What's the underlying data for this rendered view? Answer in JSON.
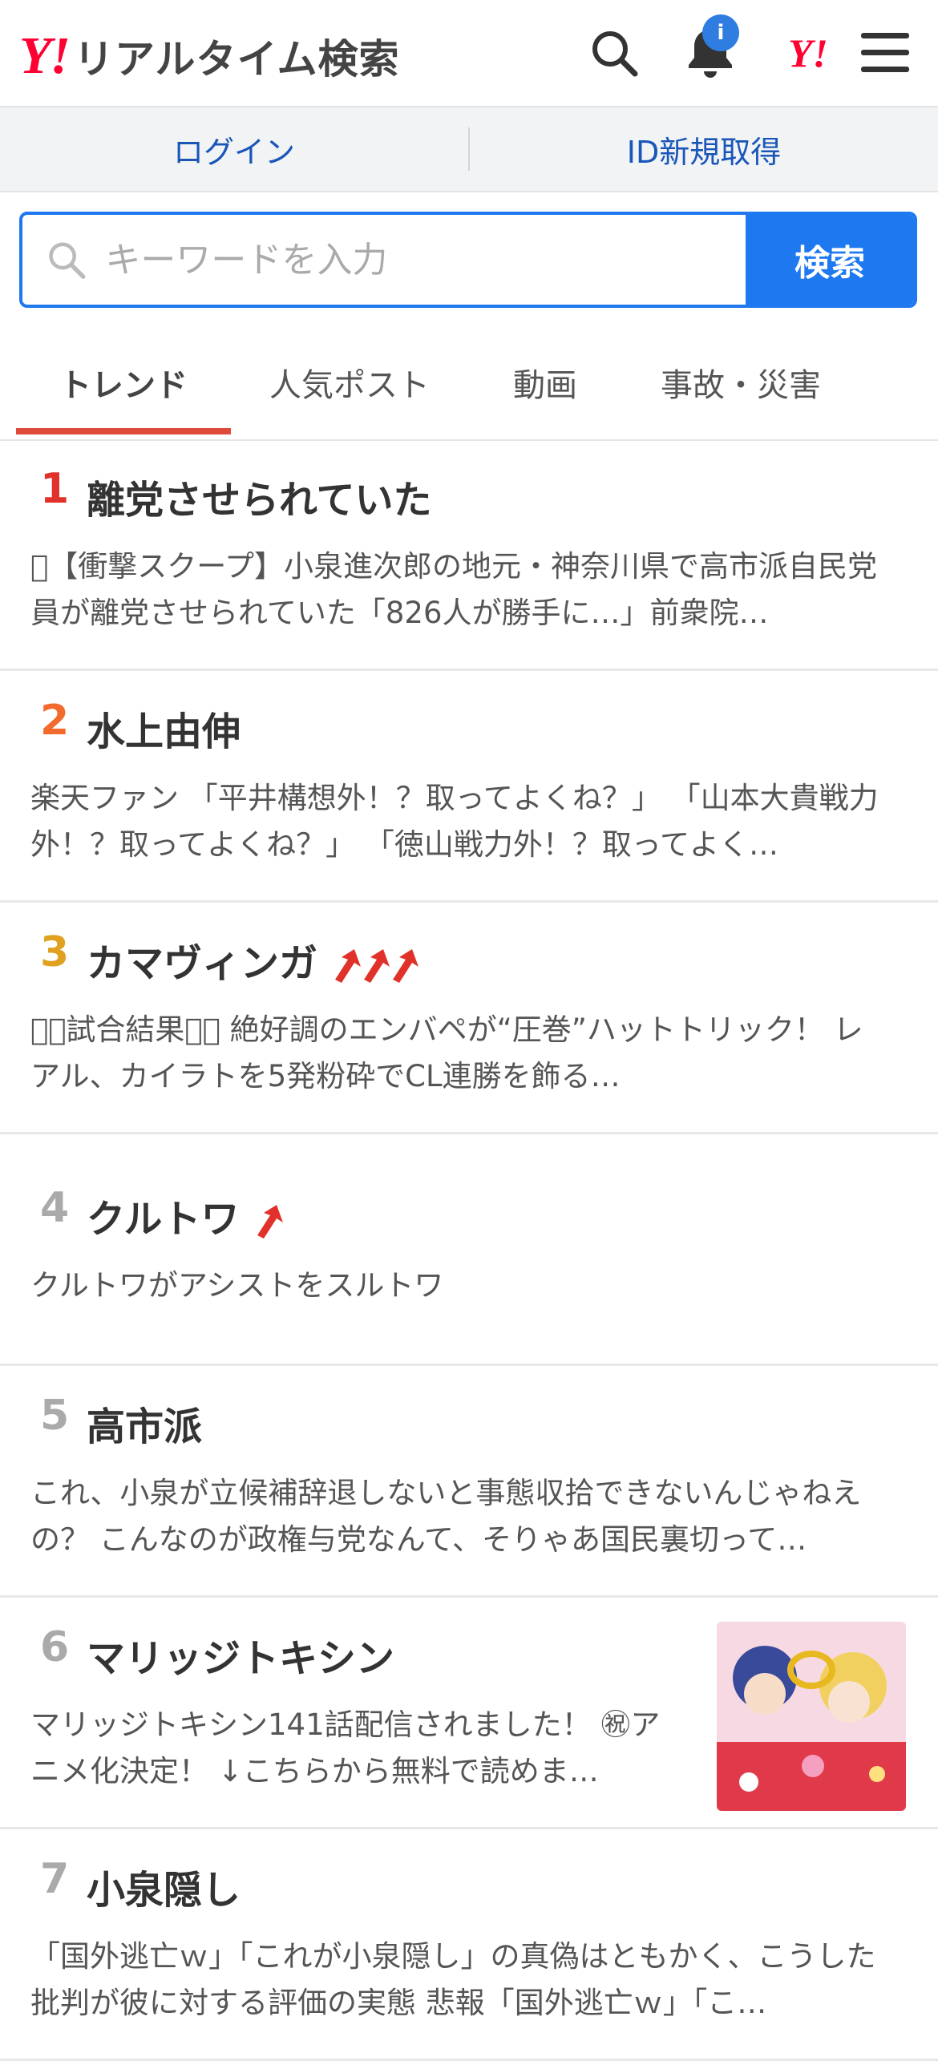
{
  "header": {
    "logo_mark": "Y!",
    "logo_text": "リアルタイム検索",
    "notification_badge": "i",
    "yahoo_mark": "Y!"
  },
  "login": {
    "login_label": "ログイン",
    "signup_label": "ID新規取得"
  },
  "search": {
    "placeholder": "キーワードを入力",
    "button_label": "検索"
  },
  "tabs": [
    {
      "label": "トレンド",
      "active": true
    },
    {
      "label": "人気ポスト"
    },
    {
      "label": "動画"
    },
    {
      "label": "事故・災害"
    }
  ],
  "colors": {
    "accent": "#1e78f0",
    "tab_underline": "#e04a3c",
    "rank1": "#e0322a",
    "rank2": "#f26a2c",
    "rank3": "#e0a020",
    "rank_other": "#aaaaaa",
    "trend_arrow": "#e0322a"
  },
  "trends": [
    {
      "rank": "1",
      "title": "離党させられていた",
      "arrows": 0,
      "desc": "􀀀【衝撃スクープ】小泉進次郎の地元・神奈川県で高市派自民党員が離党させられていた「826人が勝手に…」前衆院…"
    },
    {
      "rank": "2",
      "title": "水上由伸",
      "arrows": 0,
      "desc": "楽天ファン 「平井構想外！？取ってよくね？」 「山本大貴戦力外！？取ってよくね？」 「徳山戦力外！？取ってよく…"
    },
    {
      "rank": "3",
      "title": "カマヴィンガ",
      "arrows": 3,
      "desc": "􀀀􀀀試合結果􀀀􀀀 絶好調のエンバペが“圧巻”ハットトリック！ レアル、カイラトを5発粉砕でCL連勝を飾る…"
    },
    {
      "rank": "4",
      "title": "クルトワ",
      "arrows": 1,
      "desc": "クルトワがアシストをスルトワ"
    },
    {
      "rank": "5",
      "title": "高市派",
      "arrows": 0,
      "desc": "これ、小泉が立候補辞退しないと事態収拾できないんじゃねえの？ こんなのが政権与党なんて、そりゃあ国民裏切って…"
    },
    {
      "rank": "6",
      "title": "マリッジトキシン",
      "arrows": 0,
      "has_thumb": true,
      "desc": "マリッジトキシン141話配信されました！ ㊗アニメ化決定！ ↓こちらから無料で読めま…"
    },
    {
      "rank": "7",
      "title": "小泉隠し",
      "arrows": 0,
      "desc": "「国外逃亡ｗ」「これが小泉隠し」の真偽はともかく、こうした批判が彼に対する評価の実態 悲報「国外逃亡ｗ」「こ…"
    }
  ]
}
